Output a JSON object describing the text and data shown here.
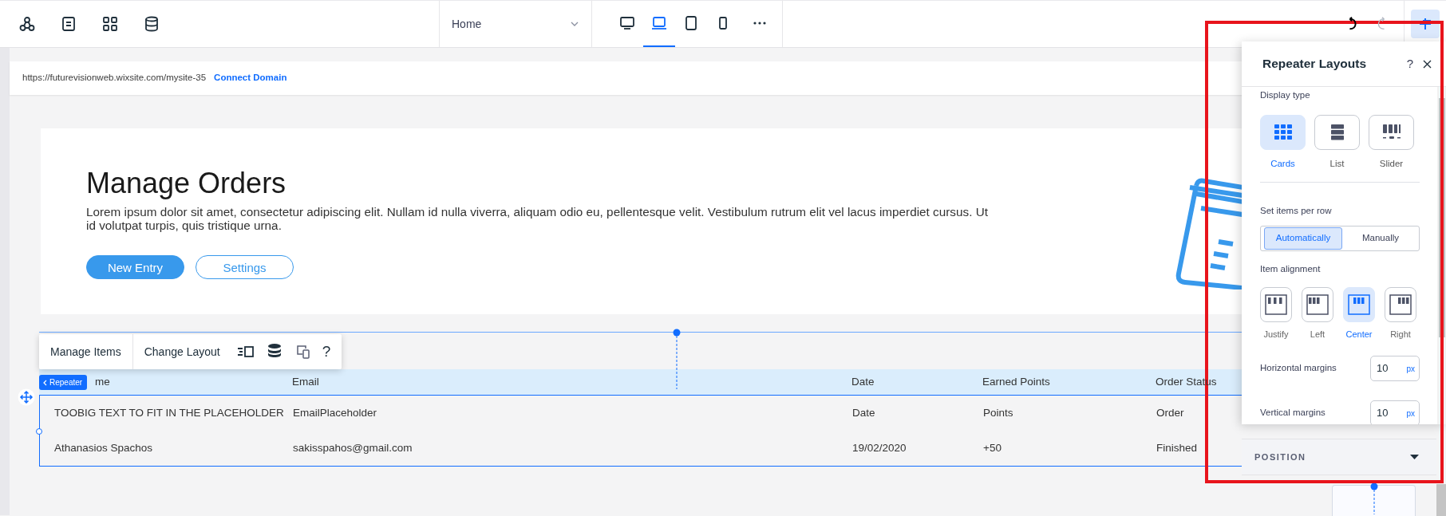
{
  "top_bar": {
    "page_select": {
      "value": "Home"
    },
    "devices": [
      {
        "kind": "desktop",
        "selected": false
      },
      {
        "kind": "laptop",
        "selected": true
      },
      {
        "kind": "tablet",
        "selected": false
      },
      {
        "kind": "mobile",
        "selected": false
      }
    ],
    "history": [
      {
        "kind": "undo",
        "disabled": false
      },
      {
        "kind": "redo",
        "disabled": true
      }
    ]
  },
  "url_bar": {
    "url": "https://futurevisionweb.wixsite.com/mysite-35",
    "link": "Connect Domain"
  },
  "hero": {
    "title": "Manage Orders",
    "description": "Lorem ipsum dolor sit amet, consectetur adipiscing elit. Nullam id nulla viverra, aliquam odio eu, pellentesque velit. Vestibulum rutrum elit vel lacus imperdiet cursus. Ut id volutpat turpis, quis tristique urna.",
    "buttons": [
      {
        "label": "New Entry",
        "kind": "primary"
      },
      {
        "label": "Settings",
        "kind": "outline"
      }
    ]
  },
  "repeater": {
    "toolbar": [
      {
        "kind": "text",
        "label": "Manage Items"
      },
      {
        "kind": "text",
        "label": "Change Layout"
      },
      {
        "kind": "layout"
      },
      {
        "kind": "database"
      },
      {
        "kind": "devices"
      },
      {
        "kind": "text",
        "label": "?"
      }
    ],
    "badge": "Repeater",
    "columns": [
      "me",
      "Email",
      "Date",
      "Earned Points",
      "Order Status"
    ],
    "rows": [
      [
        "TOOBIG TEXT TO FIT IN THE PLACEHOLDER",
        "EmailPlaceholder",
        "Date",
        "Points",
        "Order"
      ],
      [
        "Athanasios Spachos",
        "sakisspahos@gmail.com",
        "19/02/2020",
        "+50",
        "Finished"
      ]
    ]
  },
  "panel": {
    "title": "Repeater Layouts",
    "help": "?",
    "display_type": {
      "label": "Display type",
      "options": [
        {
          "label": "Cards",
          "kind": "cards",
          "selected": true
        },
        {
          "label": "List",
          "kind": "list",
          "selected": false
        },
        {
          "label": "Slider",
          "kind": "slider",
          "selected": false
        }
      ]
    },
    "items_per_row": {
      "label": "Set items per row",
      "options": [
        {
          "label": "Automatically",
          "selected": true
        },
        {
          "label": "Manually",
          "selected": false
        }
      ]
    },
    "alignment": {
      "label": "Item alignment",
      "options": [
        {
          "label": "Justify",
          "kind": "justify",
          "selected": false
        },
        {
          "label": "Left",
          "kind": "left",
          "selected": false
        },
        {
          "label": "Center",
          "kind": "center",
          "selected": true
        },
        {
          "label": "Right",
          "kind": "right",
          "selected": false
        }
      ]
    },
    "margins": [
      {
        "label": "Horizontal margins",
        "value": "10",
        "unit": "px"
      },
      {
        "label": "Vertical margins",
        "value": "10",
        "unit": "px"
      }
    ]
  },
  "position_section": {
    "label": "POSITION"
  }
}
